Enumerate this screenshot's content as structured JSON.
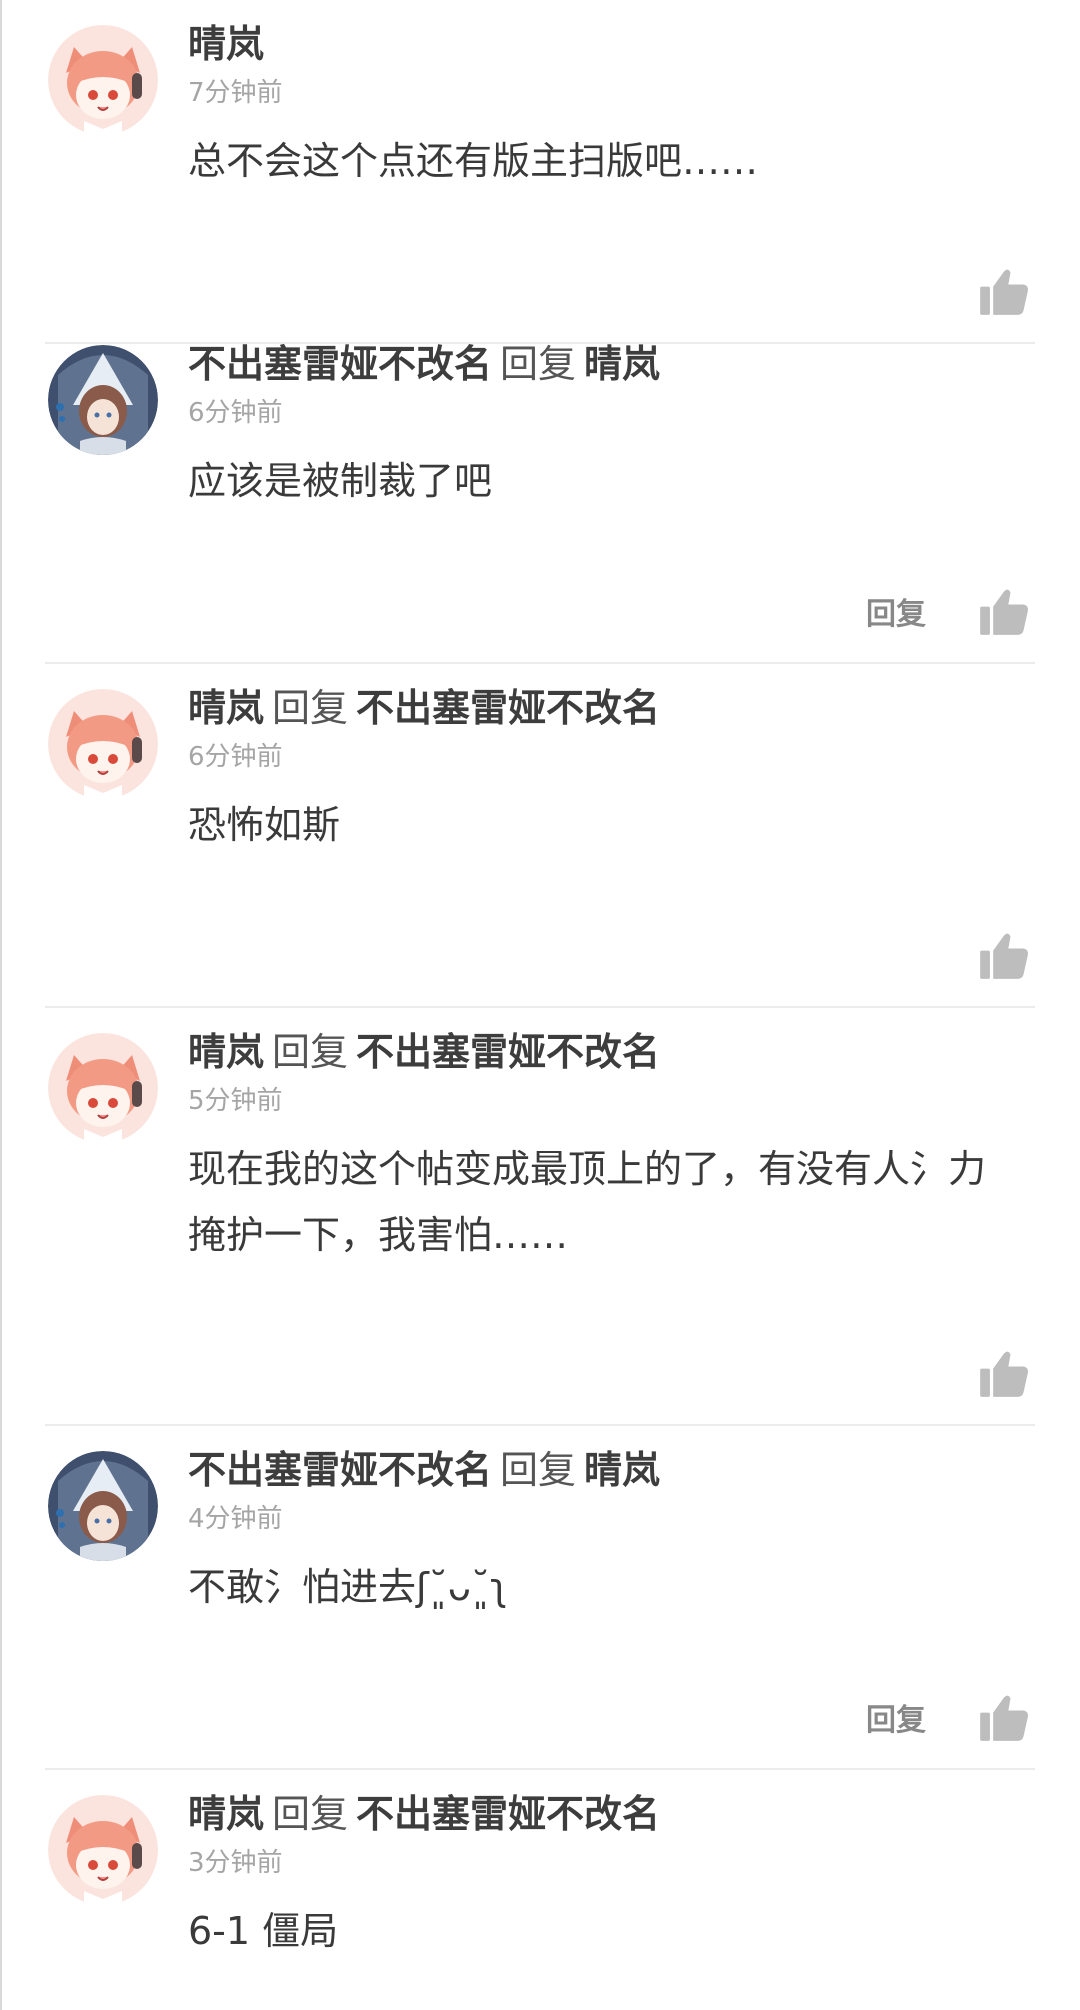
{
  "comments": [
    {
      "name": "晴岚",
      "reply_label": "",
      "reply_to": "",
      "time": "7分钟前",
      "text": "总不会这个点还有版主扫版吧……",
      "has_reply_button": false
    },
    {
      "name": "不出塞雷娅不改名",
      "reply_label": "回复",
      "reply_to": "晴岚",
      "time": "6分钟前",
      "text": "应该是被制裁了吧",
      "has_reply_button": true
    },
    {
      "name": "晴岚",
      "reply_label": "回复",
      "reply_to": "不出塞雷娅不改名",
      "time": "6分钟前",
      "text": "恐怖如斯",
      "has_reply_button": false
    },
    {
      "name": "晴岚",
      "reply_label": "回复",
      "reply_to": "不出塞雷娅不改名",
      "time": "5分钟前",
      "text": "现在我的这个帖变成最顶上的了，有没有人氵力掩护一下，我害怕……",
      "has_reply_button": false
    },
    {
      "name": "不出塞雷娅不改名",
      "reply_label": "回复",
      "reply_to": "晴岚",
      "time": "4分钟前",
      "text": "不敢氵怕进去ʃ˘͈ᴗ˘͈ʅ",
      "has_reply_button": true
    },
    {
      "name": "晴岚",
      "reply_label": "回复",
      "reply_to": "不出塞雷娅不改名",
      "time": "3分钟前",
      "text": "6-1 僵局",
      "has_reply_button": false
    }
  ],
  "reply_button_label": "回复",
  "icons": {
    "like": "thumbs-up-icon",
    "avatar_a": "cat-girl-avatar",
    "avatar_b": "blue-hood-avatar"
  },
  "colors": {
    "name": "#3d3d3d",
    "time": "#a5a5a5",
    "icon": "#bdbdbd",
    "divider": "#ececec"
  }
}
